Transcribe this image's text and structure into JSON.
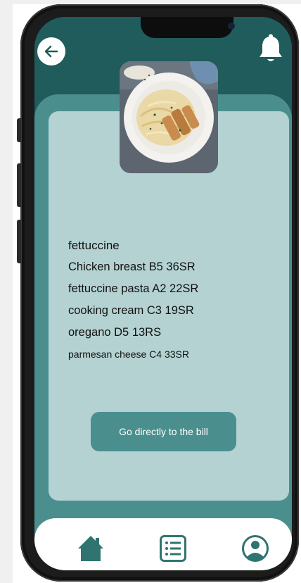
{
  "header": {
    "back_icon": "arrow-left-icon",
    "notification_icon": "bell-icon"
  },
  "dish": {
    "image_icon": "fettuccine-chicken-plate-photo",
    "items": [
      "fettuccine",
      "Chicken breast  B5 36SR",
      "fettuccine pasta A2 22SR",
      "cooking cream  C3 19SR",
      "oregano D5 13RS",
      "parmesan cheese C4 33SR"
    ]
  },
  "actions": {
    "bill_button_label": "Go directly to the bill"
  },
  "bottom_nav": {
    "items": [
      {
        "icon": "home-icon"
      },
      {
        "icon": "list-icon"
      },
      {
        "icon": "profile-icon"
      }
    ]
  },
  "colors": {
    "header": "#1f5c5b",
    "panel": "#4a8f8e",
    "card": "#b4d2d2",
    "button": "#4a8f8e",
    "nav_icons": "#2f7470"
  }
}
